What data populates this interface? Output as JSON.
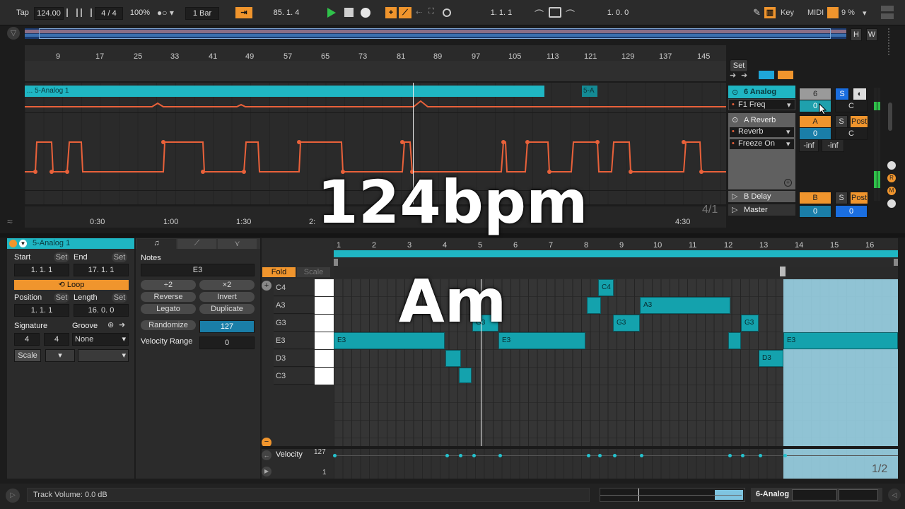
{
  "transport": {
    "tap": "Tap",
    "tempo": "124.00",
    "signature": "4 / 4",
    "zoom": "100%",
    "quantize": "1 Bar",
    "position": "85.  1.  4",
    "loop_start": "1.  1.  1",
    "loop_length": "1.  0.  0",
    "key_label": "Key",
    "midi_label": "MIDI",
    "cpu": "9 %"
  },
  "ruler": {
    "bars": [
      "9",
      "17",
      "25",
      "33",
      "41",
      "49",
      "57",
      "65",
      "73",
      "81",
      "89",
      "97",
      "105",
      "113",
      "121",
      "129",
      "137",
      "145"
    ],
    "times": [
      "0:30",
      "1:00",
      "1:30",
      "2:",
      "4:30"
    ],
    "page": "4/1"
  },
  "arrangement": {
    "clip_name": "... 5-Analog 1",
    "clip2_name": "5-A",
    "set_label": "Set",
    "h": "H",
    "w": "W"
  },
  "mixer": {
    "track1": "6 Analog",
    "param1": "F1 Freq",
    "track1_num": "6",
    "s": "S",
    "value0": "0",
    "c": "C",
    "track2": "A Reverb",
    "a_btn": "A",
    "post": "Post",
    "device2": "Reverb",
    "param2": "Freeze On",
    "inf1": "-inf",
    "inf2": "-inf",
    "track3": "B Delay",
    "b_btn": "B",
    "master": "Master",
    "r": "R",
    "m": "M"
  },
  "clip": {
    "name": "5-Analog 1",
    "start_label": "Start",
    "end_label": "End",
    "set": "Set",
    "start": "1.   1.   1",
    "end": "17.   1.   1",
    "loop": "Loop",
    "position_label": "Position",
    "length_label": "Length",
    "position": "1.   1.   1",
    "length": "16.   0.   0",
    "signature_label": "Signature",
    "groove_label": "Groove",
    "sig_num": "4",
    "sig_den": "4",
    "groove": "None",
    "scale": "Scale"
  },
  "notes_panel": {
    "title": "Notes",
    "pitch": "E3",
    "div2": "÷2",
    "mul2": "×2",
    "reverse": "Reverse",
    "invert": "Invert",
    "legato": "Legato",
    "duplicate": "Duplicate",
    "randomize": "Randomize",
    "rand_val": "127",
    "vel_range_label": "Velocity Range",
    "vel_range": "0"
  },
  "editor": {
    "fold": "Fold",
    "scale": "Scale",
    "bars": [
      "1",
      "2",
      "3",
      "4",
      "5",
      "6",
      "7",
      "8",
      "9",
      "10",
      "11",
      "12",
      "13",
      "14",
      "15",
      "16"
    ],
    "keys": [
      "C4",
      "A3",
      "G3",
      "E3",
      "D3",
      "C3"
    ],
    "velocity_label": "Velocity",
    "vel_max": "127",
    "vel_min": "1",
    "page": "1/2",
    "notes": [
      {
        "label": "E3"
      },
      {
        "label": ""
      },
      {
        "label": ""
      },
      {
        "label": "G3"
      },
      {
        "label": "E3"
      },
      {
        "label": ""
      },
      {
        "label": "C4"
      },
      {
        "label": "G3"
      },
      {
        "label": "A3"
      },
      {
        "label": ""
      },
      {
        "label": "G3"
      },
      {
        "label": "D3"
      },
      {
        "label": "E3"
      }
    ]
  },
  "overlay": {
    "tempo": "124bpm",
    "key": "Am"
  },
  "status": {
    "message": "Track Volume: 0.0 dB",
    "track": "6-Analog"
  }
}
